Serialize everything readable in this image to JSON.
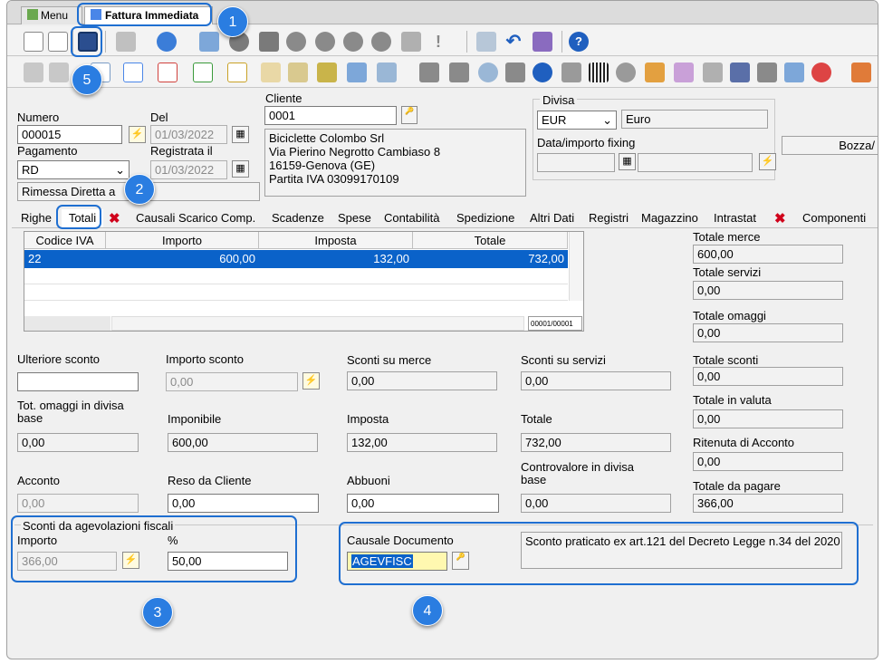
{
  "window_tabs": {
    "menu": "Menu",
    "active": "Fattura Immediata"
  },
  "header": {
    "numero_label": "Numero",
    "numero_value": "000015",
    "del_label": "Del",
    "del_value": "01/03/2022",
    "pagamento_label": "Pagamento",
    "pagamento_value": "RD",
    "registrata_label": "Registrata il",
    "registrata_value": "01/03/2022",
    "pagamento_desc": "Rimessa Diretta a",
    "cliente_label": "Cliente",
    "cliente_value": "0001",
    "cliente_address": [
      "Biciclette Colombo Srl",
      "Via Pierino Negrotto Cambiaso 8",
      "16159-Genova (GE)",
      "Partita IVA 03099170109"
    ],
    "divisa_label": "Divisa",
    "divisa_value": "EUR",
    "divisa_desc": "Euro",
    "fixing_label": "Data/importo fixing",
    "status": "Bozza/"
  },
  "tabs": [
    "Righe",
    "Totali",
    "Causali Scarico Comp.",
    "Scadenze",
    "Spese",
    "Contabilità",
    "Spedizione",
    "Altri Dati",
    "Registri",
    "Magazzino",
    "Intrastat",
    "Componenti"
  ],
  "grid": {
    "headers": [
      "Codice IVA",
      "Importo",
      "Imposta",
      "Totale"
    ],
    "row": [
      "22",
      "600,00",
      "132,00",
      "732,00"
    ],
    "counter": "00001/00001"
  },
  "totals": {
    "merce": {
      "label": "Totale merce",
      "value": "600,00"
    },
    "servizi": {
      "label": "Totale servizi",
      "value": "0,00"
    },
    "omaggi": {
      "label": "Totale omaggi",
      "value": "0,00"
    },
    "sconti": {
      "label": "Totale sconti",
      "value": "0,00"
    },
    "valuta": {
      "label": "Totale in valuta",
      "value": "0,00"
    },
    "ritenuta": {
      "label": "Ritenuta di Acconto",
      "value": "0,00"
    },
    "pagare": {
      "label": "Totale da pagare",
      "value": "366,00"
    }
  },
  "fields": {
    "ulteriore_sconto": {
      "label": "Ulteriore sconto",
      "value": ""
    },
    "importo_sconto": {
      "label": "Importo sconto",
      "value": "0,00"
    },
    "sconti_merce": {
      "label": "Sconti su merce",
      "value": "0,00"
    },
    "sconti_servizi": {
      "label": "Sconti su servizi",
      "value": "0,00"
    },
    "tot_omaggi": {
      "label": "Tot. omaggi in divisa base",
      "value": "0,00"
    },
    "imponibile": {
      "label": "Imponibile",
      "value": "600,00"
    },
    "imposta": {
      "label": "Imposta",
      "value": "132,00"
    },
    "totale": {
      "label": "Totale",
      "value": "732,00"
    },
    "acconto": {
      "label": "Acconto",
      "value": "0,00"
    },
    "reso": {
      "label": "Reso da Cliente",
      "value": "0,00"
    },
    "abbuoni": {
      "label": "Abbuoni",
      "value": "0,00"
    },
    "controvalore": {
      "label": "Controvalore in divisa base",
      "value": "0,00"
    }
  },
  "agevolazioni": {
    "title": "Sconti da agevolazioni fiscali",
    "importo_label": "Importo",
    "importo_value": "366,00",
    "perc_label": "%",
    "perc_value": "50,00"
  },
  "causale": {
    "label": "Causale Documento",
    "code": "AGEVFISC",
    "desc": "Sconto praticato ex art.121 del Decreto Legge n.34 del 2020"
  },
  "callouts": [
    "1",
    "2",
    "3",
    "4",
    "5"
  ],
  "colors": {
    "accent": "#1f6fd1",
    "selection": "#0a62c9",
    "callout": "#2a7de1"
  }
}
